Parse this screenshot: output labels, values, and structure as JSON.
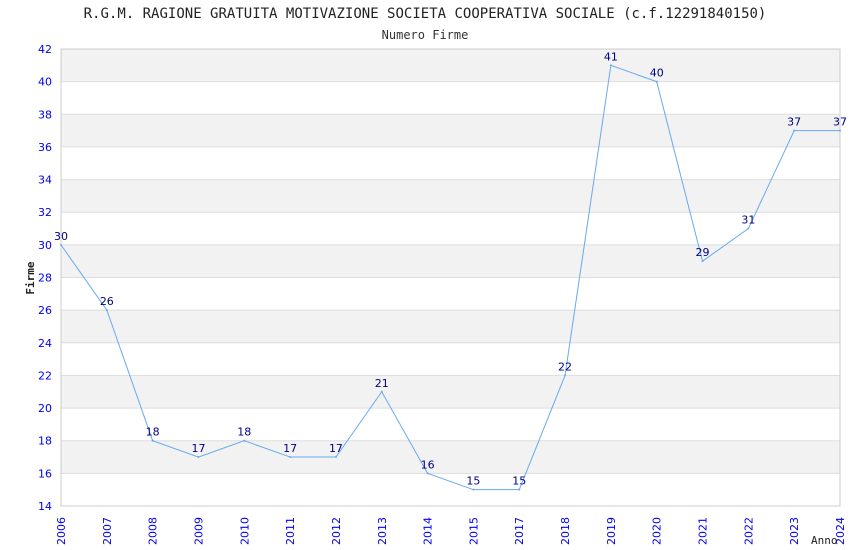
{
  "chart_data": {
    "type": "line",
    "title": "R.G.M. RAGIONE GRATUITA MOTIVAZIONE SOCIETA COOPERATIVA SOCIALE (c.f.12291840150)",
    "subtitle": "Numero Firme",
    "xlabel": "Anno",
    "ylabel": "Firme",
    "ylim": [
      14,
      42
    ],
    "yticks": [
      14,
      16,
      18,
      20,
      22,
      24,
      26,
      28,
      30,
      32,
      34,
      36,
      38,
      40,
      42
    ],
    "grid": true,
    "categories": [
      "2006",
      "2007",
      "2008",
      "2009",
      "2010",
      "2011",
      "2012",
      "2013",
      "2014",
      "2015",
      "2017",
      "2018",
      "2019",
      "2020",
      "2021",
      "2022",
      "2023",
      "2024"
    ],
    "values": [
      30,
      26,
      18,
      17,
      18,
      17,
      17,
      21,
      16,
      15,
      15,
      22,
      41,
      40,
      29,
      31,
      37,
      37
    ],
    "colors": {
      "line": "#66aaee",
      "tick": "#0000ee",
      "label": "#000080",
      "band": "#f2f2f2"
    }
  }
}
